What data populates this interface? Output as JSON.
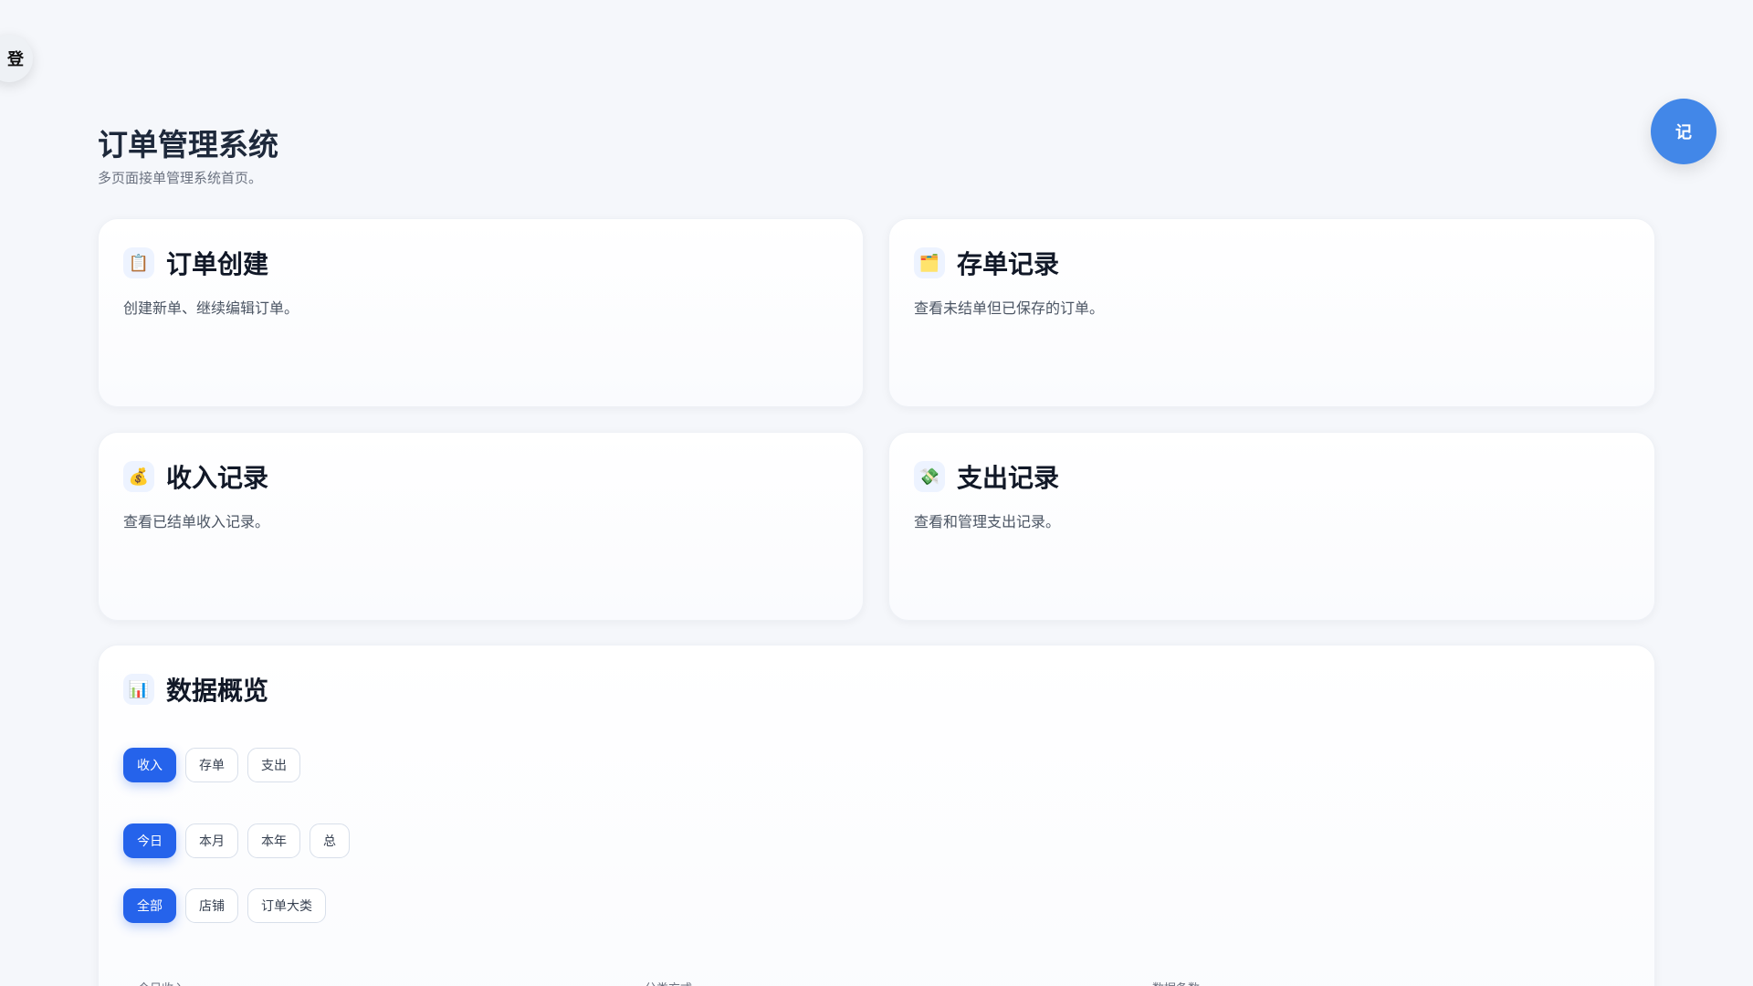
{
  "fab_left": "登",
  "fab_right": "记",
  "header": {
    "title": "订单管理系统",
    "subtitle": "多页面接单管理系统首页。"
  },
  "cards": [
    {
      "title": "订单创建",
      "desc": "创建新单、继续编辑订单。",
      "icon": "📋"
    },
    {
      "title": "存单记录",
      "desc": "查看未结单但已保存的订单。",
      "icon": "🗂️"
    },
    {
      "title": "收入记录",
      "desc": "查看已结单收入记录。",
      "icon": "💰"
    },
    {
      "title": "支出记录",
      "desc": "查看和管理支出记录。",
      "icon": "💸"
    }
  ],
  "overview": {
    "title": "数据概览",
    "icon": "📊",
    "type_buttons": [
      "收入",
      "存单",
      "支出"
    ],
    "period_buttons": [
      "今日",
      "本月",
      "本年",
      "总"
    ],
    "group_buttons": [
      "全部",
      "店铺",
      "订单大类"
    ],
    "labels": [
      "今日收入",
      "分类方式",
      "数据条数"
    ]
  }
}
